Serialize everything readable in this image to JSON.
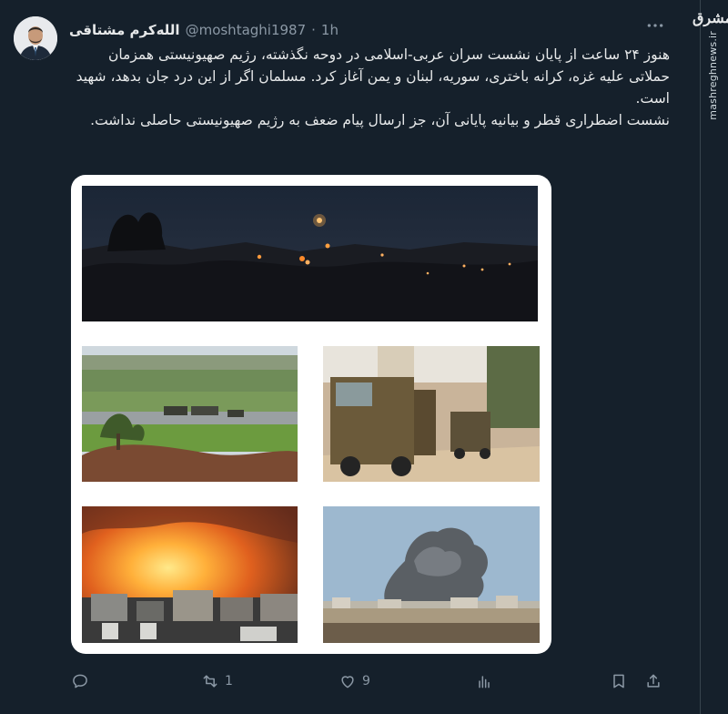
{
  "author": {
    "name": "الله‌کرم مشتاقی",
    "handle": "@moshtaghi1987",
    "separator": "·",
    "time": "1h"
  },
  "tweet": {
    "paragraph1": "هنوز ۲۴ ساعت از پایان نشست سران عربی-اسلامی در دوحه نگذشته، رژیم صهیونیستی همزمان حملاتی علیه غزه، کرانه باختری، سوریه، لبنان و یمن آغاز کرد. مسلمان اگر از این درد جان بدهد، شهید است.",
    "paragraph2": "نشست اضطراری قطر و بیانیه پایانی آن، جز ارسال پیام ضعف به رژیم صهیونیستی حاصلی نداشت."
  },
  "watermark": {
    "logo": "مشرق",
    "site": "mashreghnews.ir"
  },
  "images": [
    {
      "id": "night-fires",
      "icon": "night-hills-fires"
    },
    {
      "id": "field-vehicles",
      "icon": "field-military-vehicles"
    },
    {
      "id": "armored-vehicles",
      "icon": "armored-vehicles-street"
    },
    {
      "id": "fire-explosion",
      "icon": "large-fire-explosion"
    },
    {
      "id": "smoke-plume",
      "icon": "smoke-plume-city"
    }
  ],
  "actions": {
    "reply_count": "",
    "retweet_count": "1",
    "like_count": "9",
    "views_count": ""
  },
  "colors": {
    "background": "#15202b",
    "text": "#e7e9ea",
    "muted": "#8b98a5",
    "border": "#38444d"
  }
}
